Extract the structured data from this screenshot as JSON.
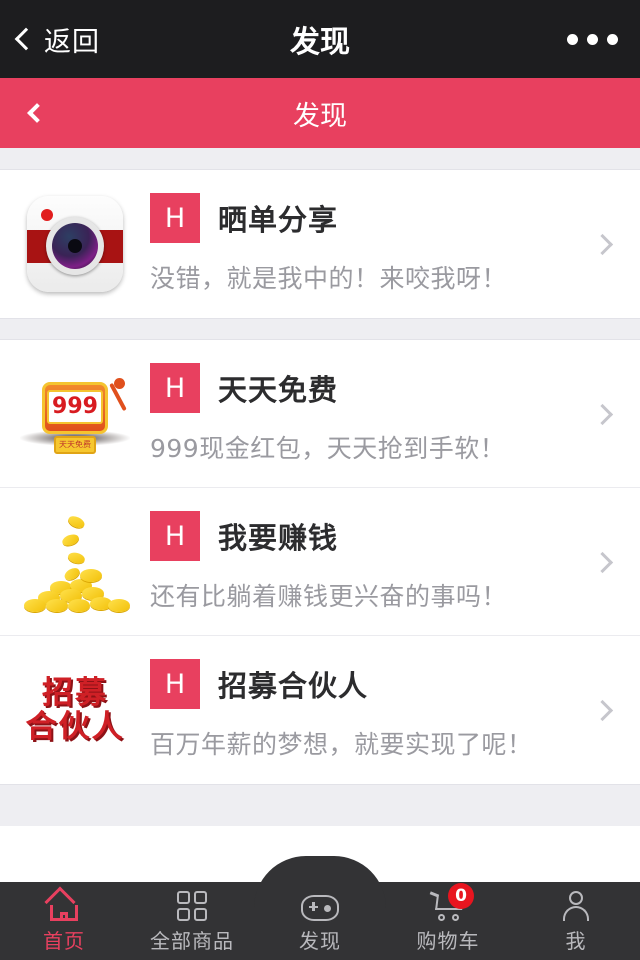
{
  "system_bar": {
    "back_label": "返回",
    "title": "发现",
    "more_icon": "more-dots-icon"
  },
  "app_header": {
    "title": "发现",
    "back_icon": "chevron-left-icon",
    "accent_color": "#e8405f"
  },
  "list": {
    "items": [
      {
        "badge": "H",
        "title": "晒单分享",
        "subtitle": "没错，就是我中的！来咬我呀！",
        "thumb_icon": "camera-icon",
        "chevron_icon": "chevron-right-icon"
      },
      {
        "badge": "H",
        "title": "天天免费",
        "subtitle": "999现金红包，天天抢到手软！",
        "thumb_icon": "slot-machine-icon",
        "thumb_text": "999",
        "thumb_plate_text": "天天免费",
        "chevron_icon": "chevron-right-icon"
      },
      {
        "badge": "H",
        "title": "我要赚钱",
        "subtitle": "还有比躺着赚钱更兴奋的事吗！",
        "thumb_icon": "gold-coins-icon",
        "chevron_icon": "chevron-right-icon"
      },
      {
        "badge": "H",
        "title": "招募合伙人",
        "subtitle": "百万年薪的梦想，就要实现了呢！",
        "thumb_icon": "recruit-partner-logo",
        "thumb_line1": "招募",
        "thumb_line2": "合伙人",
        "chevron_icon": "chevron-right-icon"
      }
    ]
  },
  "tabbar": {
    "active_color": "#e8405f",
    "inactive_color": "#b9b9bd",
    "items": [
      {
        "label": "首页",
        "icon": "home-icon",
        "active": true
      },
      {
        "label": "全部商品",
        "icon": "grid-icon",
        "active": false
      },
      {
        "label": "发现",
        "icon": "gamepad-icon",
        "active": false
      },
      {
        "label": "购物车",
        "icon": "cart-icon",
        "active": false,
        "badge": "0"
      },
      {
        "label": "我",
        "icon": "person-icon",
        "active": false
      }
    ]
  }
}
